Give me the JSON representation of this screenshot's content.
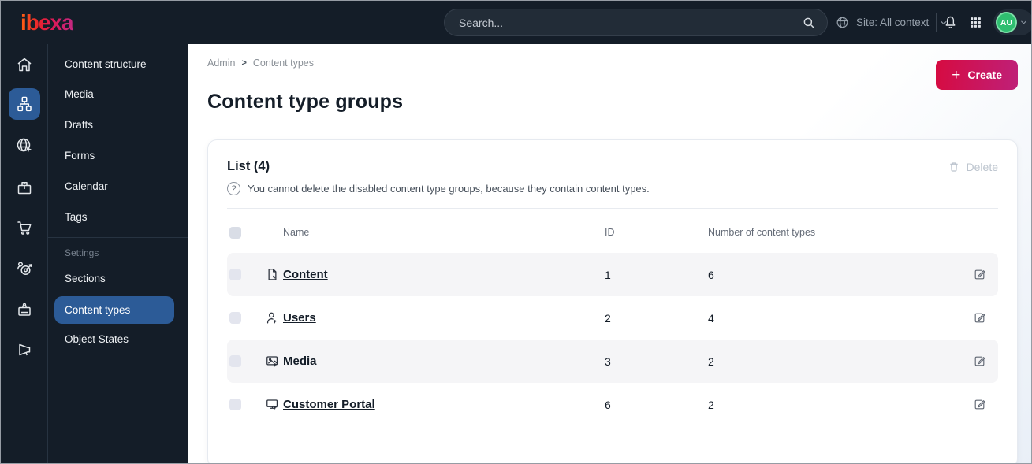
{
  "topbar": {
    "logo_text": "ibexa",
    "search": {
      "placeholder": "Search..."
    },
    "site_context": {
      "label": "Site: All context"
    },
    "avatar": {
      "initials": "AU"
    },
    "icons": [
      "search-icon",
      "globe-icon",
      "chevron-down-icon",
      "bell-icon",
      "app-grid-icon"
    ]
  },
  "sidebar": {
    "rail_icons": [
      "home-icon",
      "content-tree-icon",
      "site-icon",
      "product-catalog-icon",
      "cart-icon",
      "personalization-icon",
      "admin-badge-icon",
      "marketing-megaphone-icon"
    ],
    "items": [
      {
        "label": "Content structure"
      },
      {
        "label": "Media"
      },
      {
        "label": "Drafts"
      },
      {
        "label": "Forms"
      },
      {
        "label": "Calendar"
      },
      {
        "label": "Tags"
      }
    ],
    "settings_header": "Settings",
    "settings_items": [
      {
        "label": "Sections",
        "active": false
      },
      {
        "label": "Content types",
        "active": true
      },
      {
        "label": "Object States",
        "active": false
      }
    ]
  },
  "main": {
    "breadcrumb": {
      "items": [
        "Admin",
        "Content types"
      ],
      "separator": ">"
    },
    "create_button": {
      "label": "Create",
      "plus": "+"
    },
    "page_title": "Content type groups",
    "card": {
      "list_title": "List (4)",
      "help": {
        "glyph": "?",
        "text": "You cannot delete the disabled content type groups, because they contain content types."
      },
      "delete_button": {
        "label": "Delete"
      },
      "table": {
        "columns": {
          "name": "Name",
          "id": "ID",
          "count": "Number of content types"
        },
        "rows": [
          {
            "icon": "content-file-icon",
            "name": "Content",
            "id": "1",
            "count": "6"
          },
          {
            "icon": "users-icon",
            "name": "Users",
            "id": "2",
            "count": "4"
          },
          {
            "icon": "media-image-icon",
            "name": "Media",
            "id": "3",
            "count": "2"
          },
          {
            "icon": "customer-portal-monitor-icon",
            "name": "Customer Portal",
            "id": "6",
            "count": "2"
          }
        ]
      }
    }
  },
  "colors": {
    "topbar_bg": "#141d28",
    "sidebar_bg": "#141d28",
    "active_blue": "#2c5b97",
    "brand_gradient": [
      "#ff6112",
      "#e8232f",
      "#dc1a58",
      "#c32982"
    ],
    "create_gradient": [
      "#d60b41",
      "#bf2078"
    ],
    "avatar_green": "#2fbe70",
    "row_stripe": "#f5f5f7",
    "disabled_text": "#bcc4ce"
  }
}
